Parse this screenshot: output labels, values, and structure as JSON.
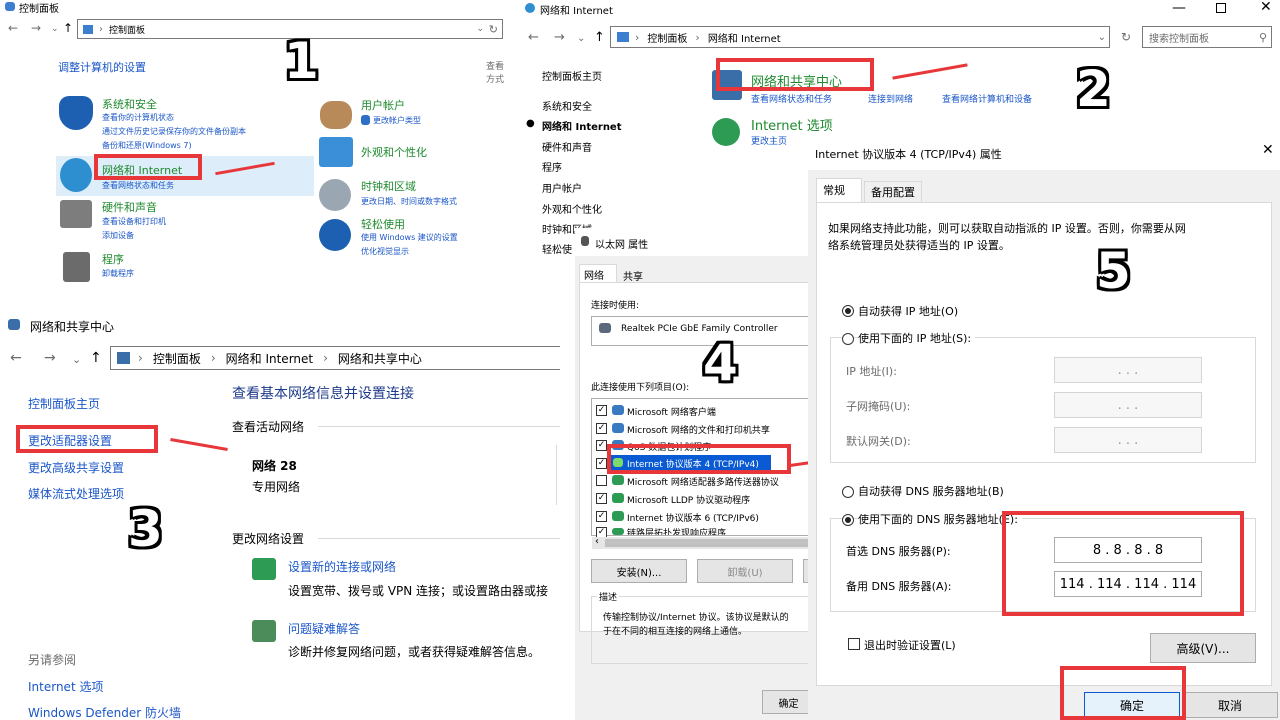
{
  "p1": {
    "title": "控制面板",
    "bc": "控制面板",
    "heading": "调整计算机的设置",
    "viewby": "查看方式",
    "sec": {
      "title": "系统和安全",
      "l1": "查看你的计算机状态",
      "l2": "通过文件历史记录保存你的文件备份副本",
      "l3": "备份和还原(Windows 7)"
    },
    "net": {
      "title": "网络和 Internet",
      "l1": "查看网络状态和任务"
    },
    "hw": {
      "title": "硬件和声音",
      "l1": "查看设备和打印机",
      "l2": "添加设备"
    },
    "prog": {
      "title": "程序",
      "l1": "卸载程序"
    },
    "user": {
      "title": "用户帐户",
      "l1": "更改帐户类型"
    },
    "appear": {
      "title": "外观和个性化"
    },
    "clock": {
      "title": "时钟和区域",
      "l1": "更改日期、时间或数字格式"
    },
    "ease": {
      "title": "轻松使用",
      "l1": "使用 Windows 建议的设置",
      "l2": "优化视觉显示"
    }
  },
  "p2": {
    "title": "网络和 Internet",
    "bc1": "控制面板",
    "bc2": "网络和 Internet",
    "search": "搜索控制面板",
    "side": [
      "控制面板主页",
      "系统和安全",
      "网络和 Internet",
      "硬件和声音",
      "程序",
      "用户帐户",
      "外观和个性化",
      "时钟和区域",
      "轻松使"
    ],
    "nsc": {
      "title": "网络和共享中心",
      "l1": "查看网络状态和任务",
      "l2": "连接到网络",
      "l3": "查看网络计算机和设备"
    },
    "io": {
      "title": "Internet 选项",
      "l1": "更改主页"
    }
  },
  "p3": {
    "title": "网络和共享中心",
    "bc1": "控制面板",
    "bc2": "网络和 Internet",
    "bc3": "网络和共享中心",
    "side": [
      "控制面板主页",
      "更改适配器设置",
      "更改高级共享设置",
      "媒体流式处理选项"
    ],
    "heading": "查看基本网络信息并设置连接",
    "active": "查看活动网络",
    "netname": "网络 28",
    "nettype": "专用网络",
    "change": "更改网络设置",
    "set_title": "设置新的连接或网络",
    "set_desc": "设置宽带、拨号或 VPN 连接；或设置路由器或接",
    "trb_title": "问题疑难解答",
    "trb_desc": "诊断并修复网络问题，或者获得疑难解答信息。",
    "see": "另请参阅",
    "see1": "Internet 选项",
    "see2": "Windows Defender 防火墙"
  },
  "p4": {
    "title": "以太网 属性",
    "tab1": "网络",
    "tab2": "共享",
    "conn_label": "连接时使用:",
    "adapter": "Realtek PCIe GbE Family Controller",
    "items_label": "此连接使用下列项目(O):",
    "items": [
      "Microsoft 网络客户端",
      "Microsoft 网络的文件和打印机共享",
      "QoS 数据包计划程序",
      "Internet 协议版本 4 (TCP/IPv4)",
      "Microsoft 网络适配器多路传送器协议",
      "Microsoft LLDP 协议驱动程序",
      "Internet 协议版本 6 (TCP/IPv6)",
      "链路层拓扑发现响应程序"
    ],
    "install": "安装(N)...",
    "uninstall": "卸载(U)",
    "desc_label": "描述",
    "desc": "传输控制协议/Internet 协议。该协议是默认的",
    "desc2": "于在不同的相互连接的网络上通信。",
    "ok": "确定"
  },
  "p5": {
    "title": "Internet 协议版本 4 (TCP/IPv4) 属性",
    "tab1": "常规",
    "tab2": "备用配置",
    "intro1": "如果网络支持此功能，则可以获取自动指派的 IP 设置。否则，你需要从网",
    "intro2": "络系统管理员处获得适当的 IP 设置。",
    "auto_ip": "自动获得 IP 地址(O)",
    "use_ip": "使用下面的 IP 地址(S):",
    "ip": "IP 地址(I):",
    "mask": "子网掩码(U):",
    "gw": "默认网关(D):",
    "dots": ". . .",
    "auto_dns": "自动获得 DNS 服务器地址(B)",
    "use_dns": "使用下面的 DNS 服务器地址(E):",
    "pref": "首选 DNS 服务器(P):",
    "alt": "备用 DNS 服务器(A):",
    "pref_val": "8 . 8 . 8 . 8",
    "alt_val": "114 . 114 . 114 . 114",
    "validate": "退出时验证设置(L)",
    "adv": "高级(V)...",
    "ok": "确定",
    "cancel": "取消"
  },
  "steps": {
    "s1": "1",
    "s2": "2",
    "s3": "3",
    "s4": "4",
    "s5": "5"
  },
  "colors": {
    "red": "#e8373a",
    "link": "#1a56c8",
    "green": "#1e8a2e"
  }
}
